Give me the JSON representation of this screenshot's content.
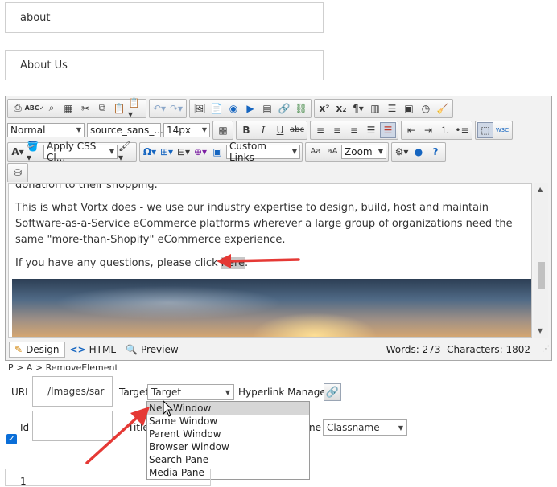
{
  "fields": {
    "field1_value": "about",
    "field2_value": "About Us"
  },
  "toolbar": {
    "paragraph_style": "Normal",
    "font_name": "source_sans_...",
    "font_size": "14px",
    "apply_css": "Apply CSS Cl...",
    "custom_links": "Custom Links",
    "zoom": "Zoom"
  },
  "content": {
    "line1": "donation to their shopping.",
    "para2": "This is what Vortx does - we use our industry expertise to design, build, host and maintain Software-as-a-Service eCommerce platforms wherever a large group of organizations need the same \"more-than-Shopify\" eCommerce experience.",
    "para3_before": "If you have any questions, please click ",
    "para3_link": "here",
    "para3_after": "."
  },
  "modes": {
    "design": "Design",
    "html": "HTML",
    "preview": "Preview",
    "words": "Words: 273",
    "characters": "Characters: 1802"
  },
  "breadcrumb": "P > A > RemoveElement",
  "link_panel": {
    "url_label": "URL",
    "url_value": "/Images/sar",
    "target_label": "Target",
    "target_selected": "Target",
    "hyperlink_manager": "Hyperlink Manager",
    "id_label": "Id",
    "title_label": "Title",
    "classname_label_partial": "ne",
    "classname_value": "Classname",
    "target_options": [
      "New Window",
      "Same Window",
      "Parent Window",
      "Browser Window",
      "Search Pane",
      "Media Pane"
    ]
  },
  "bottom_box": "1",
  "colors": {
    "annotation_arrow": "#e53935",
    "checkbox": "#0a6ed8"
  }
}
